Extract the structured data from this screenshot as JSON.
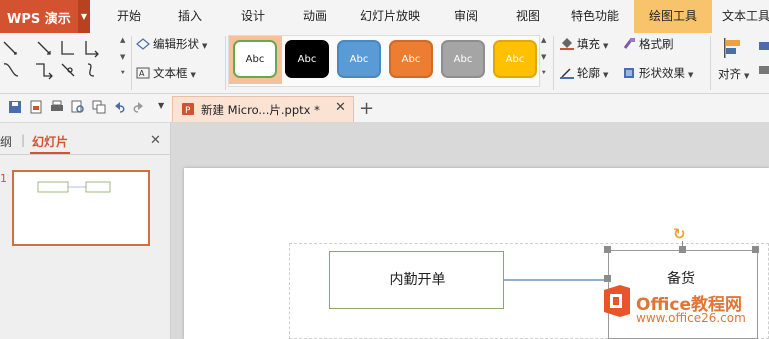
{
  "app": {
    "title": "WPS 演示"
  },
  "tabs": [
    {
      "label": "开始"
    },
    {
      "label": "插入"
    },
    {
      "label": "设计"
    },
    {
      "label": "动画"
    },
    {
      "label": "幻灯片放映"
    },
    {
      "label": "审阅"
    },
    {
      "label": "视图"
    },
    {
      "label": "特色功能"
    },
    {
      "label": "绘图工具",
      "active": true
    },
    {
      "label": "文本工具"
    }
  ],
  "ribbon": {
    "edit_shape": "编辑形状",
    "text_box": "文本框",
    "styles": [
      {
        "label": "Abc",
        "fill": "#ffffff",
        "border": "#6aa84f",
        "text": "#222222"
      },
      {
        "label": "Abc",
        "fill": "#000000",
        "border": "#000000",
        "text": "#ffffff"
      },
      {
        "label": "Abc",
        "fill": "#5b9bd5",
        "border": "#4a88c0",
        "text": "#ffffff"
      },
      {
        "label": "Abc",
        "fill": "#ed7d31",
        "border": "#d06a25",
        "text": "#ffffff"
      },
      {
        "label": "Abc",
        "fill": "#a5a5a5",
        "border": "#8e8e8e",
        "text": "#ffffff"
      },
      {
        "label": "Abc",
        "fill": "#ffc000",
        "border": "#e0a800",
        "text": "#ffffff"
      }
    ],
    "fill": "填充",
    "format_painter": "格式刷",
    "outline": "轮廓",
    "shape_effects": "形状效果",
    "align": "对齐"
  },
  "document": {
    "tab_name": "新建 Micro...片.pptx *"
  },
  "panel": {
    "tab_outline": "纲",
    "tab_slides": "幻灯片",
    "slide_number": "1"
  },
  "slide": {
    "box1_text": "内勤开单",
    "box2_text": "备货"
  },
  "watermark": {
    "line1": "Office教程网",
    "line2": "www.office26.com"
  },
  "colors": {
    "accent": "#d35230",
    "active_tab": "#f7c46c",
    "box1_border": "#8aa865",
    "connector": "#8fb0cf"
  }
}
